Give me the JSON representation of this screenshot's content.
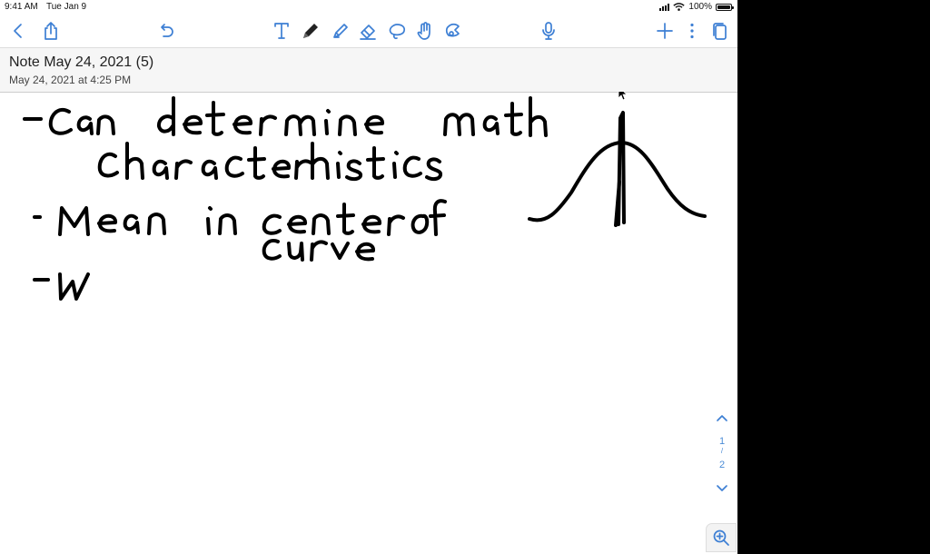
{
  "status_bar": {
    "time": "9:41 AM",
    "date": "Tue Jan 9",
    "battery": "100%"
  },
  "toolbar": {
    "left_icons": [
      "chevron-left-icon",
      "share-icon",
      "undo-icon"
    ],
    "tool_icons": [
      "text-tool-icon",
      "pen-tool-icon",
      "highlighter-tool-icon",
      "eraser-tool-icon",
      "lasso-tool-icon",
      "hand-tool-icon",
      "shapes-tool-icon"
    ],
    "right_icons": [
      "microphone-icon",
      "plus-icon",
      "more-icon",
      "pages-icon"
    ],
    "accent_color": "#3d7fd4"
  },
  "note": {
    "title": "Note May 24, 2021 (5)",
    "date": "May 24, 2021 at 4:25 PM"
  },
  "canvas": {
    "handwritten_lines": [
      "-Can determine math",
      "characteristics",
      "-Mean in center of",
      "curve",
      "-W"
    ],
    "ink_color": "#000000"
  },
  "pager": {
    "current": "1",
    "separator": "/",
    "total": "2"
  }
}
